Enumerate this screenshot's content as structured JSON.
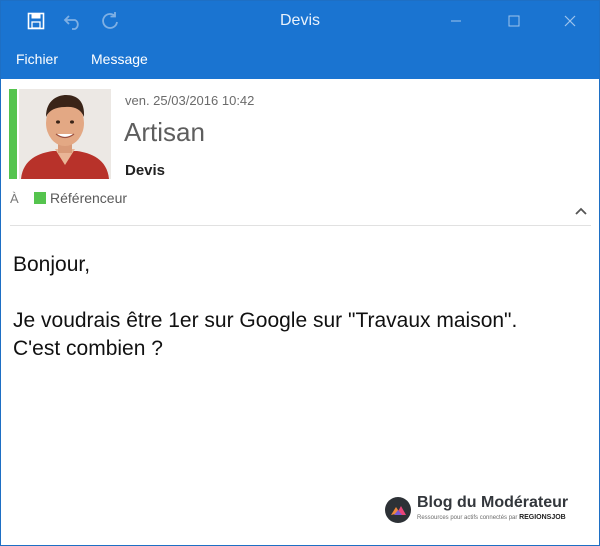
{
  "window": {
    "title": "Devis",
    "controls": [
      "minimize-icon",
      "maximize-icon",
      "close-icon"
    ]
  },
  "quick_access": [
    "save-icon",
    "undo-icon",
    "redo-icon"
  ],
  "menu": {
    "items": [
      {
        "label": "Fichier"
      },
      {
        "label": "Message"
      }
    ]
  },
  "message": {
    "date": "ven. 25/03/2016  10:42",
    "sender": "Artisan",
    "subject": "Devis",
    "to_label": "À",
    "recipient": "Référenceur",
    "body": [
      "Bonjour,",
      "",
      "Je voudrais être 1er sur Google sur \"Travaux maison\".",
      "C'est combien ?"
    ]
  },
  "watermark": {
    "title": "Blog du Modérateur",
    "tagline": "Ressources pour actifs connectés par",
    "brand": "REGIONSJOB"
  },
  "colors": {
    "titlebar": "#1a74d1",
    "accent_green": "#55c44e",
    "text": "#111111"
  }
}
